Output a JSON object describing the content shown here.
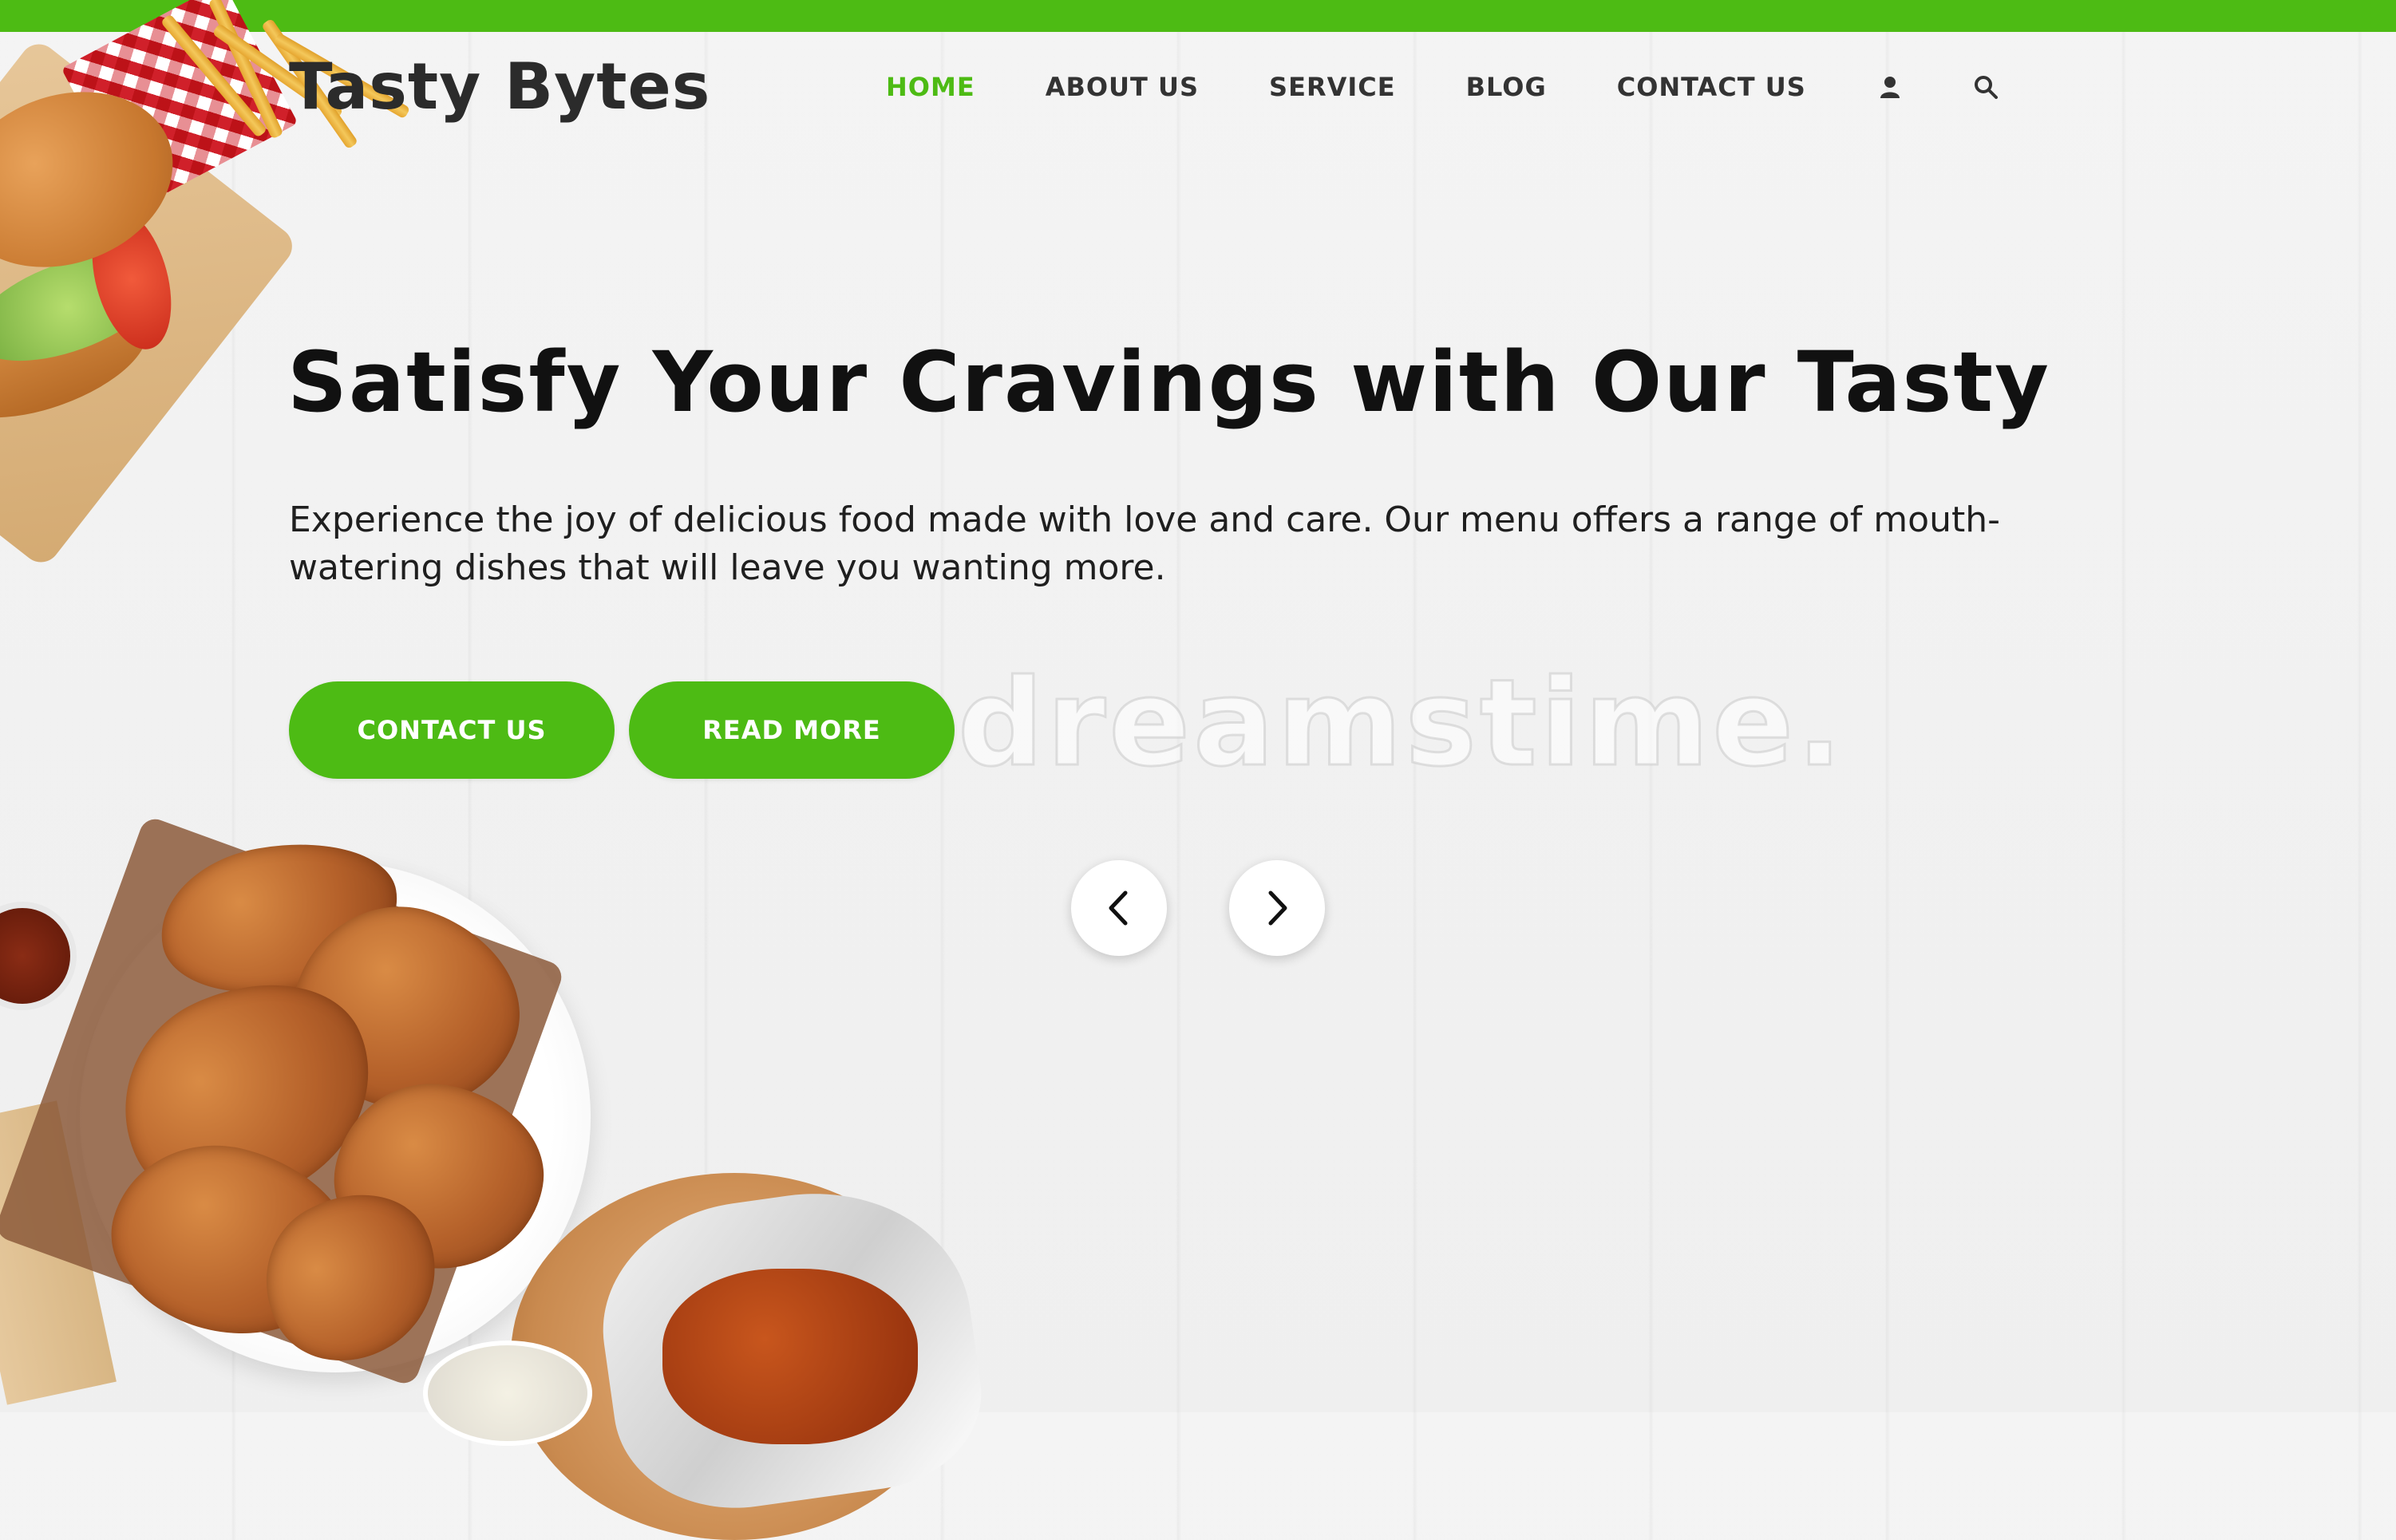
{
  "brand": {
    "accent_color": "#4dbb14",
    "logo_text": "Tasty Bytes"
  },
  "nav": {
    "items": [
      {
        "label": "HOME",
        "active": true
      },
      {
        "label": "ABOUT US",
        "active": false
      },
      {
        "label": "SERVICE",
        "active": false
      },
      {
        "label": "BLOG",
        "active": false
      },
      {
        "label": "CONTACT US",
        "active": false
      }
    ],
    "icons": [
      "user-icon",
      "search-icon"
    ]
  },
  "hero": {
    "title": "Satisfy Your Cravings with Our Tasty",
    "description": "Experience the joy of delicious food made with love and care. Our menu offers a range of mouth-watering dishes that will leave you wanting more.",
    "buttons": {
      "contact_label": "CONTACT US",
      "read_more_label": "READ MORE"
    }
  },
  "carousel": {
    "prev_icon": "chevron-left-icon",
    "next_icon": "chevron-right-icon"
  },
  "watermark_text": "dreamstime."
}
